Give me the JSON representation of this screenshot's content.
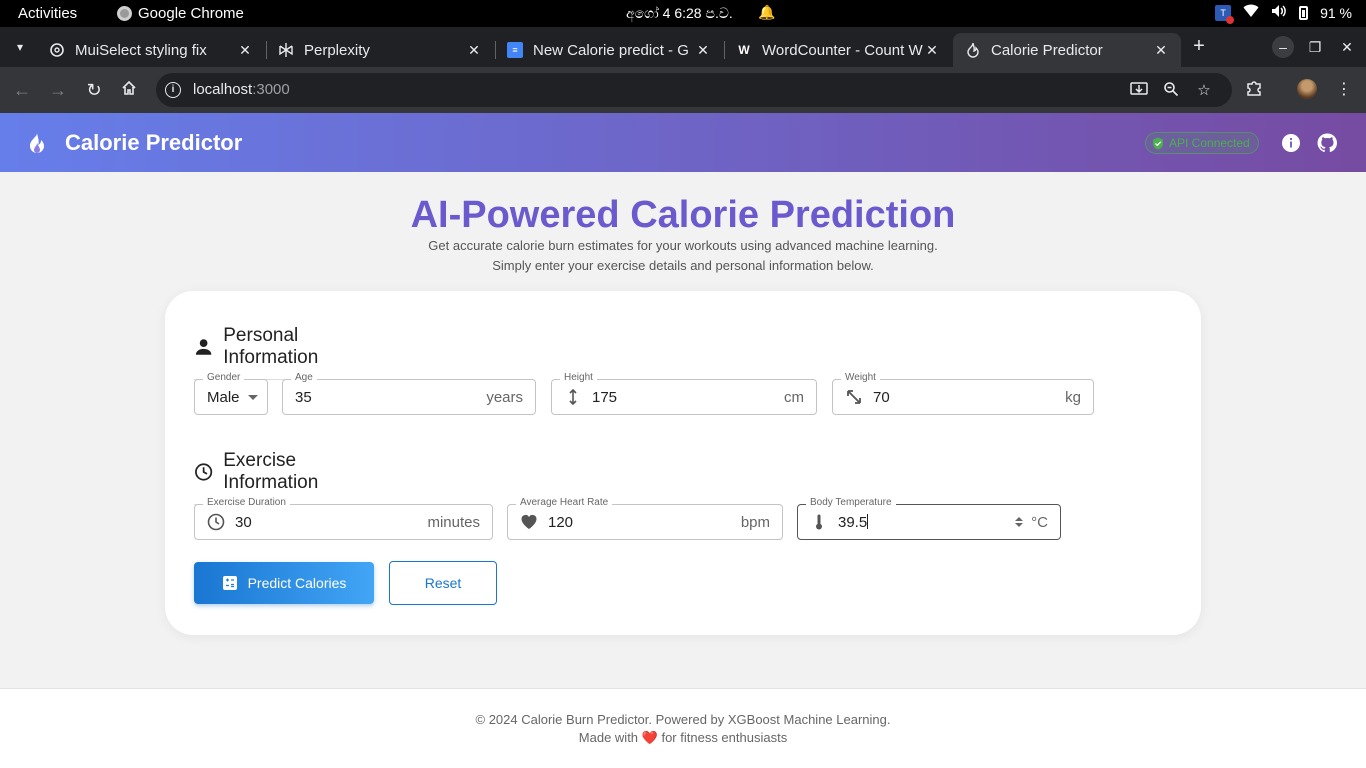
{
  "system": {
    "activities": "Activities",
    "app_name": "Google Chrome",
    "clock": "අගෝ 4   6:28 ප.ව.",
    "battery": "91 %"
  },
  "browser": {
    "tabs": [
      {
        "title": "MuiSelect styling fix",
        "icon": "openai-icon"
      },
      {
        "title": "Perplexity",
        "icon": "perplexity-icon"
      },
      {
        "title": "New Calorie predict - G",
        "icon": "google-docs-icon"
      },
      {
        "title": "WordCounter - Count W",
        "icon": "wordcounter-icon"
      },
      {
        "title": "Calorie Predictor",
        "icon": "flame-icon",
        "active": true
      }
    ],
    "url_host": "localhost",
    "url_port": ":3000"
  },
  "header": {
    "brand": "Calorie Predictor",
    "api_status": "API Connected",
    "colors": {
      "gradient_start": "#667eea",
      "gradient_end": "#764ba2",
      "status": "#4caf50"
    }
  },
  "hero": {
    "title": "AI-Powered Calorie Prediction",
    "subtitle_line1": "Get accurate calorie burn estimates for your workouts using advanced machine learning.",
    "subtitle_line2": "Simply enter your exercise details and personal information below."
  },
  "personal": {
    "heading": "Personal Information",
    "gender": {
      "label": "Gender",
      "value": "Male"
    },
    "age": {
      "label": "Age",
      "value": "35",
      "unit": "years"
    },
    "height": {
      "label": "Height",
      "value": "175",
      "unit": "cm"
    },
    "weight": {
      "label": "Weight",
      "value": "70",
      "unit": "kg"
    }
  },
  "exercise": {
    "heading": "Exercise Information",
    "duration": {
      "label": "Exercise Duration",
      "value": "30",
      "unit": "minutes"
    },
    "heart_rate": {
      "label": "Average Heart Rate",
      "value": "120",
      "unit": "bpm"
    },
    "body_temp": {
      "label": "Body Temperature",
      "value": "39.5",
      "unit": "°C"
    }
  },
  "actions": {
    "predict": "Predict Calories",
    "reset": "Reset",
    "primary_color": "#1976d2"
  },
  "footer": {
    "line1": "© 2024 Calorie Burn Predictor. Powered by XGBoost Machine Learning.",
    "line2_before": "Made with",
    "line2_heart": "❤️",
    "line2_after": "for fitness enthusiasts"
  }
}
